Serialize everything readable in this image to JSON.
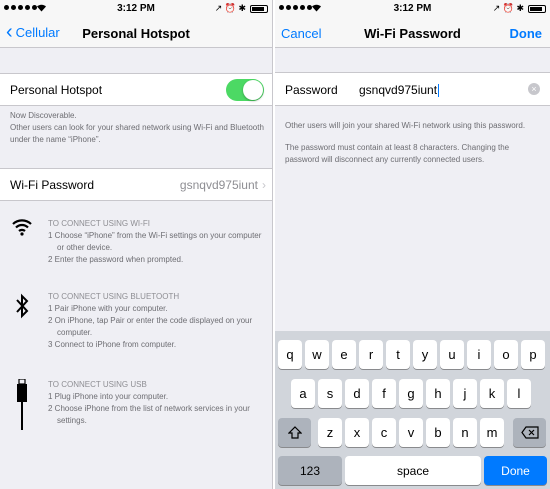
{
  "left": {
    "status": {
      "time": "3:12 PM",
      "right": "↗ ⏰ ✱"
    },
    "nav": {
      "back_label": "Cellular",
      "title": "Personal Hotspot"
    },
    "hotspot": {
      "label": "Personal Hotspot",
      "enabled": true
    },
    "footer_lines": [
      "Now Discoverable.",
      "Other users can look for your shared network using Wi-Fi and Bluetooth under the name “iPhone”."
    ],
    "wifi_password": {
      "label": "Wi-Fi Password",
      "value": "gsnqvd975iunt"
    },
    "instructions": [
      {
        "icon": "wifi-icon",
        "header": "TO CONNECT USING WI-FI",
        "steps": [
          "1 Choose “iPhone” from the Wi-Fi settings on your computer or other device.",
          "2 Enter the password when prompted."
        ]
      },
      {
        "icon": "bluetooth-icon",
        "header": "TO CONNECT USING BLUETOOTH",
        "steps": [
          "1 Pair iPhone with your computer.",
          "2 On iPhone, tap Pair or enter the code displayed on your computer.",
          "3 Connect to iPhone from computer."
        ]
      },
      {
        "icon": "usb-icon",
        "header": "TO CONNECT USING USB",
        "steps": [
          "1 Plug iPhone into your computer.",
          "2 Choose iPhone from the list of network services in your settings."
        ]
      }
    ]
  },
  "right": {
    "status": {
      "time": "3:12 PM",
      "right": "↗ ⏰ ✱"
    },
    "nav": {
      "cancel_label": "Cancel",
      "title": "Wi-Fi Password",
      "done_label": "Done"
    },
    "password": {
      "label": "Password",
      "value": "gsnqvd975iunt"
    },
    "notes": [
      "Other users will join your shared Wi-Fi network using this password.",
      "The password must contain at least 8 characters. Changing the password will disconnect any currently connected users."
    ],
    "keyboard": {
      "row1": [
        "q",
        "w",
        "e",
        "r",
        "t",
        "y",
        "u",
        "i",
        "o",
        "p"
      ],
      "row2": [
        "a",
        "s",
        "d",
        "f",
        "g",
        "h",
        "j",
        "k",
        "l"
      ],
      "row3": [
        "z",
        "x",
        "c",
        "v",
        "b",
        "n",
        "m"
      ],
      "numbers_label": "123",
      "space_label": "space",
      "done_label": "Done"
    }
  },
  "colors": {
    "accent": "#007aff",
    "toggle_on": "#4cd964"
  }
}
